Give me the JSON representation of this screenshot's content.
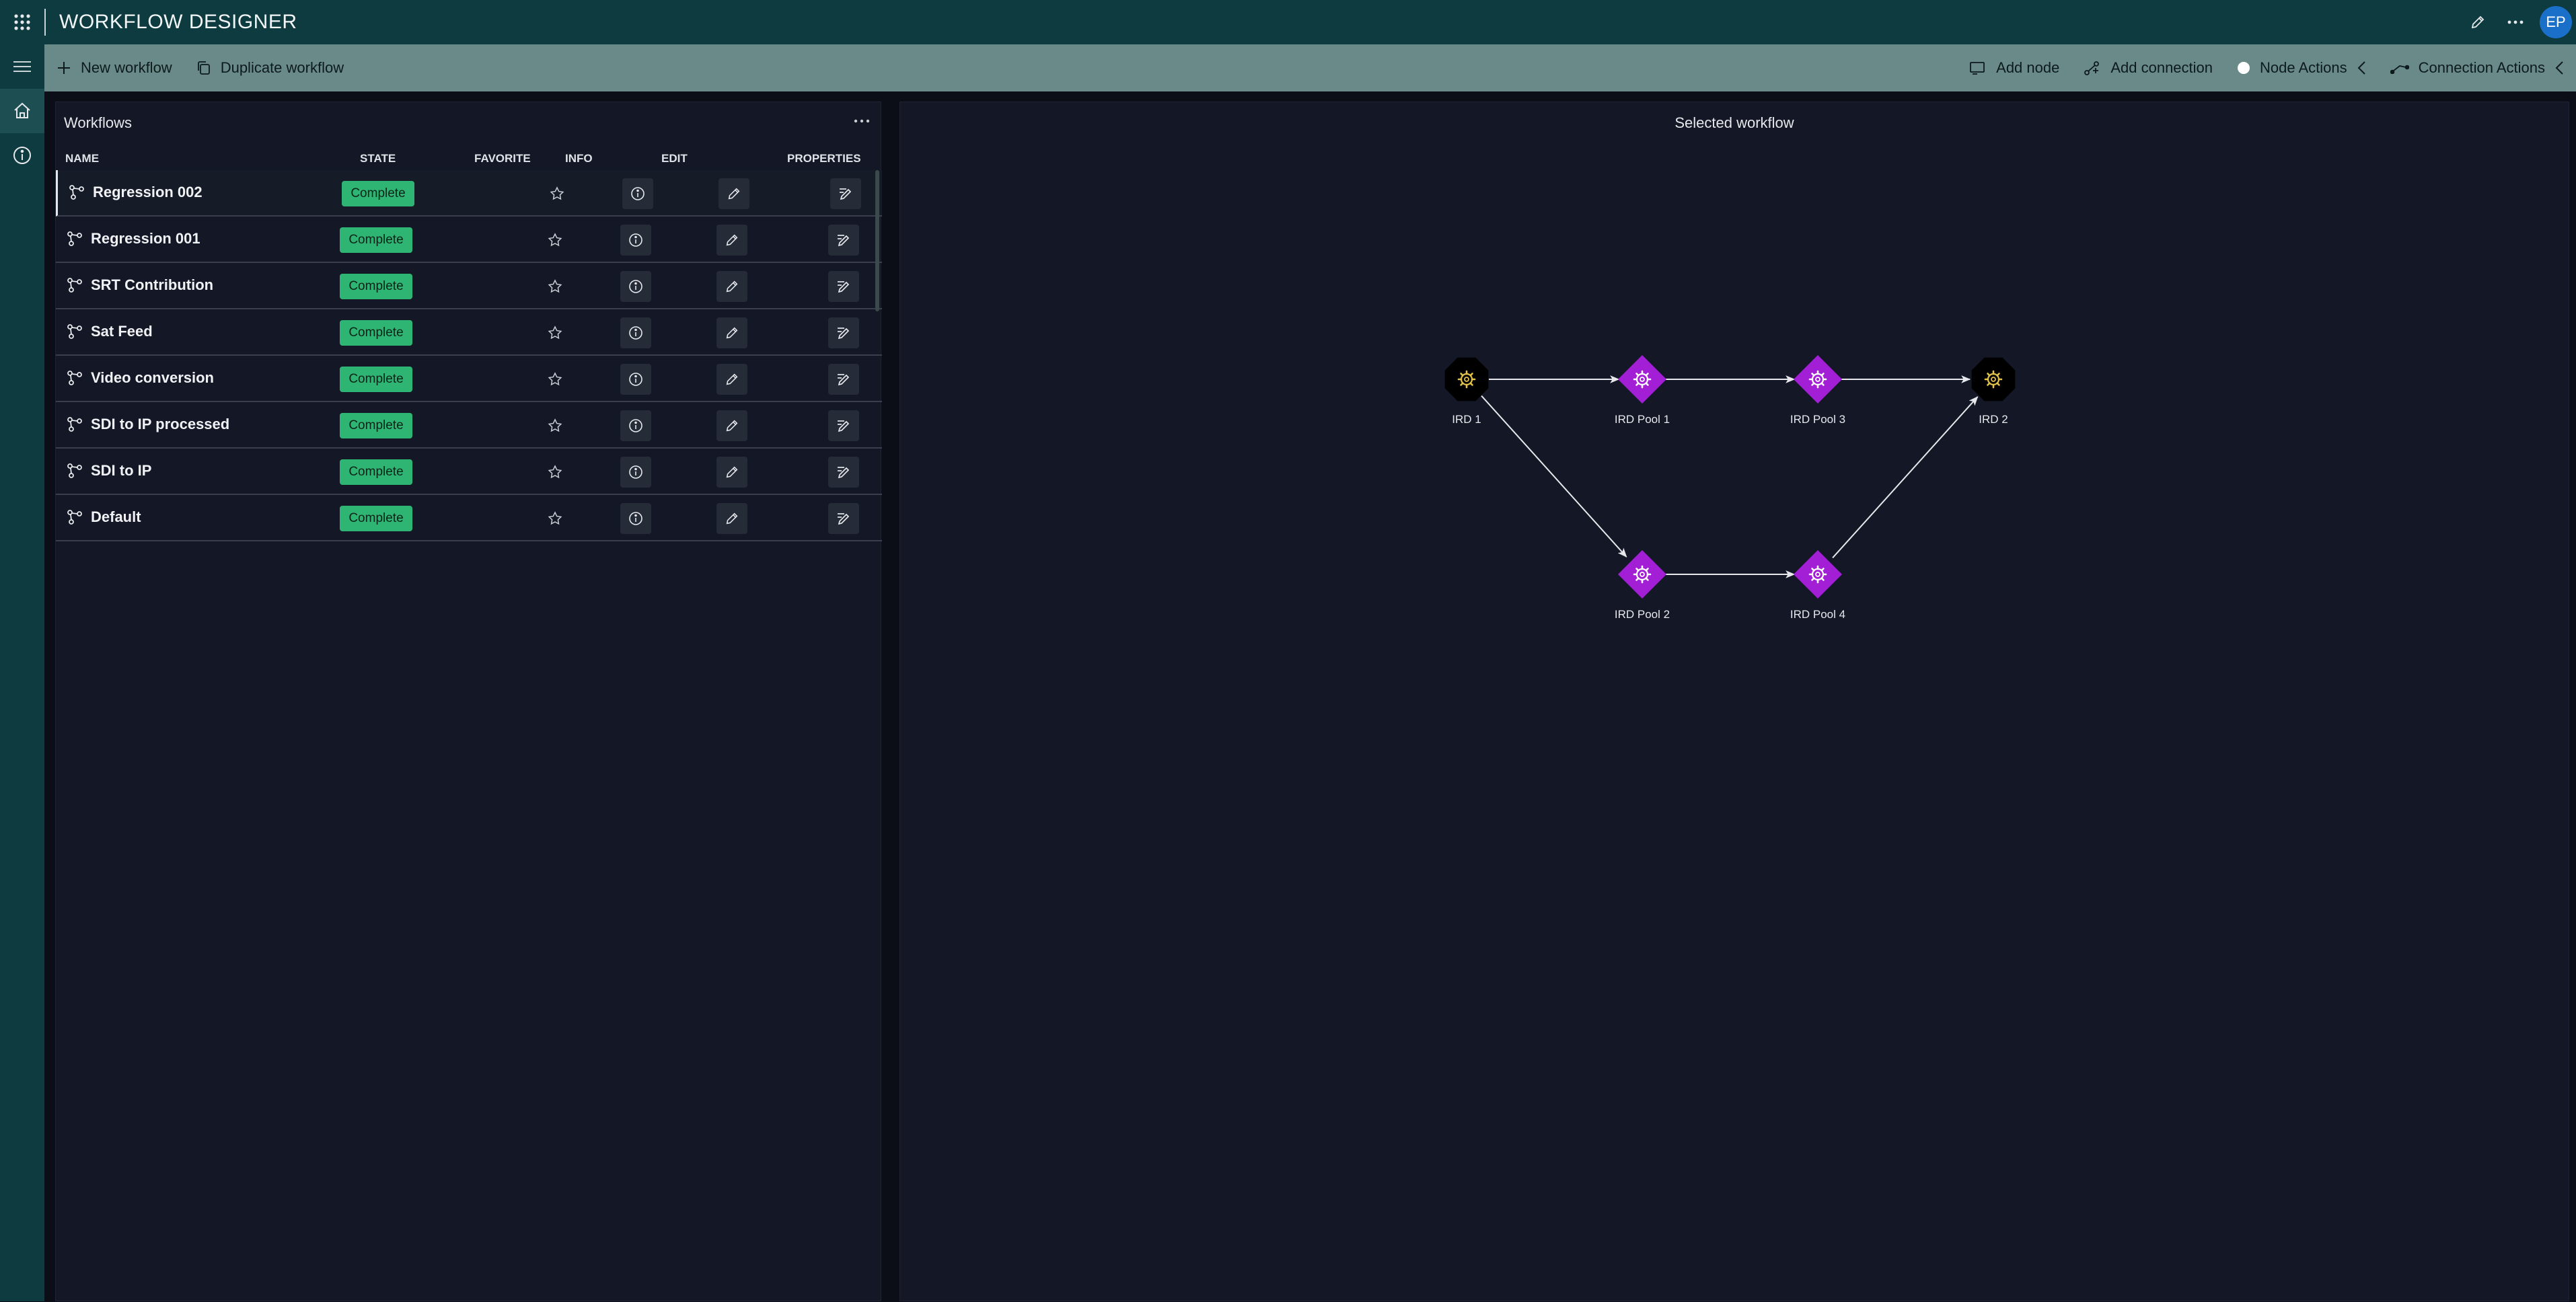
{
  "app": {
    "title": "WORKFLOW DESIGNER",
    "avatar": "EP"
  },
  "commands": {
    "left": [
      {
        "label": "New workflow",
        "icon": "plus-icon"
      },
      {
        "label": "Duplicate workflow",
        "icon": "copy-icon"
      }
    ],
    "right": [
      {
        "label": "Add node",
        "icon": "add-node-icon"
      },
      {
        "label": "Add connection",
        "icon": "add-connection-icon"
      },
      {
        "label": "Node Actions",
        "icon": "circle-icon"
      },
      {
        "label": "Connection Actions",
        "icon": "connection-icon"
      }
    ]
  },
  "workflows_panel": {
    "title": "Workflows",
    "columns": {
      "name": "NAME",
      "state": "STATE",
      "favorite": "FAVORITE",
      "info": "INFO",
      "edit": "EDIT",
      "properties": "PROPERTIES"
    },
    "rows": [
      {
        "name": "Regression 002",
        "state": "Complete"
      },
      {
        "name": "Regression 001",
        "state": "Complete"
      },
      {
        "name": "SRT Contribution",
        "state": "Complete"
      },
      {
        "name": "Sat Feed",
        "state": "Complete"
      },
      {
        "name": "Video conversion",
        "state": "Complete"
      },
      {
        "name": "SDI to IP processed",
        "state": "Complete"
      },
      {
        "name": "SDI to IP",
        "state": "Complete"
      },
      {
        "name": "Default",
        "state": "Complete"
      }
    ]
  },
  "diagram": {
    "title": "Selected workflow",
    "nodes": [
      {
        "id": "ird1",
        "label": "IRD 1",
        "kind": "endpoint"
      },
      {
        "id": "pool1",
        "label": "IRD Pool 1",
        "kind": "pool"
      },
      {
        "id": "pool3",
        "label": "IRD Pool 3",
        "kind": "pool"
      },
      {
        "id": "ird2",
        "label": "IRD 2",
        "kind": "endpoint"
      },
      {
        "id": "pool2",
        "label": "IRD Pool 2",
        "kind": "pool"
      },
      {
        "id": "pool4",
        "label": "IRD Pool 4",
        "kind": "pool"
      }
    ],
    "edges": [
      [
        "ird1",
        "pool1"
      ],
      [
        "pool1",
        "pool3"
      ],
      [
        "pool3",
        "ird2"
      ],
      [
        "ird1",
        "pool2"
      ],
      [
        "pool2",
        "pool4"
      ],
      [
        "pool4",
        "ird2"
      ]
    ],
    "colors": {
      "pool": "#a21fd6",
      "endpoint": "#000000",
      "endpoint_gear": "#e3c34a",
      "edge": "#e6e8ec"
    }
  }
}
